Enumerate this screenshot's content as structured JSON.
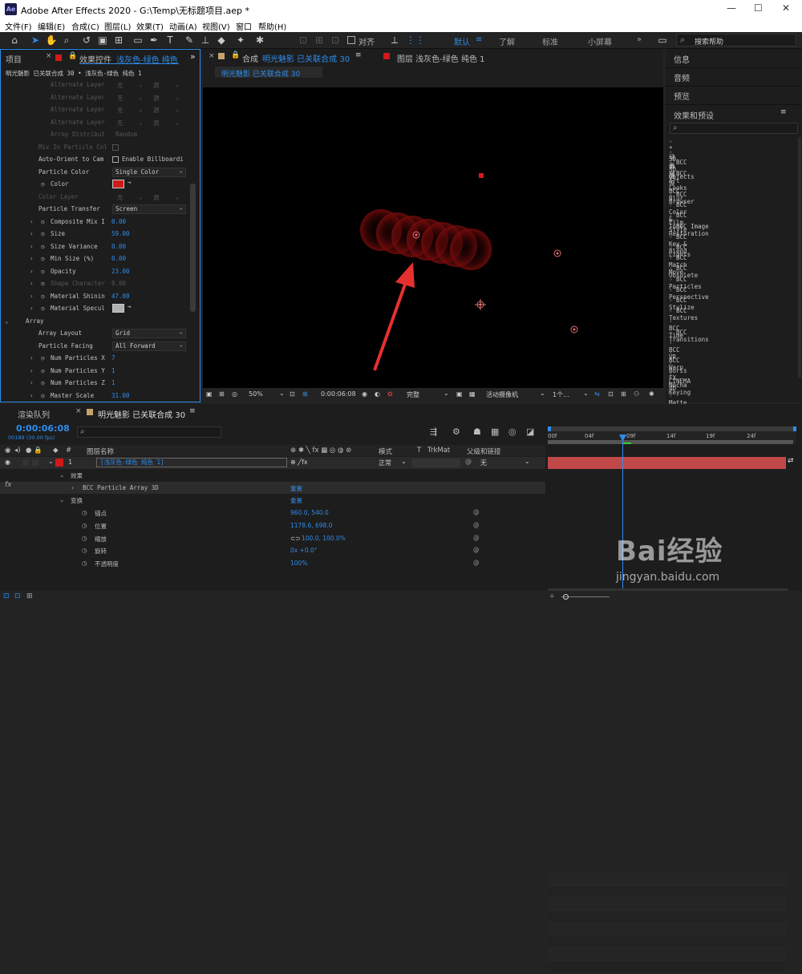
{
  "app": {
    "title": "Adobe After Effects 2020 - G:\\Temp\\无标题项目.aep *",
    "logo": "Ae"
  },
  "menu": [
    "文件(F)",
    "编辑(E)",
    "合成(C)",
    "图层(L)",
    "效果(T)",
    "动画(A)",
    "视图(V)",
    "窗口",
    "帮助(H)"
  ],
  "toolbar": {
    "snap_label": "对齐",
    "workspaces": [
      "默认",
      "了解",
      "标准",
      "小屏幕"
    ],
    "search_placeholder": "搜索帮助"
  },
  "left_panel": {
    "tab_project": "项目",
    "tab_effects_prefix": "效果控件",
    "tab_effects_layer": "浅灰色-绿色 纯色",
    "breadcrumb": "明光魅影 已关联合成 30 • 浅灰色-绿色 纯色 1",
    "rows": [
      {
        "label": "Alternate Layer",
        "value": "无",
        "kind": "dd2",
        "dis": true,
        "indent": 62
      },
      {
        "label": "Alternate Layer",
        "value": "无",
        "kind": "dd2",
        "dis": true,
        "indent": 62
      },
      {
        "label": "Alternate Layer",
        "value": "无",
        "kind": "dd2",
        "dis": true,
        "indent": 62
      },
      {
        "label": "Alternate Layer",
        "value": "无",
        "kind": "dd2",
        "dis": true,
        "indent": 62
      },
      {
        "label": "Array Distribut",
        "value": "Random",
        "kind": "text",
        "dis": true,
        "indent": 62
      },
      {
        "label": "Mix In Particle Col",
        "value": "",
        "kind": "check",
        "dis": true,
        "indent": 47
      },
      {
        "label": "Auto-Orient to Cam",
        "value": "Enable Billboardi",
        "kind": "check",
        "dis": false,
        "indent": 47
      },
      {
        "label": "Particle Color",
        "value": "Single Color",
        "kind": "dd",
        "dis": false,
        "indent": 47
      },
      {
        "label": "Color",
        "value": "",
        "kind": "color",
        "dis": false,
        "indent": 62,
        "sw": true
      },
      {
        "label": "Color Layer",
        "value": "无",
        "kind": "dd2",
        "dis": true,
        "indent": 47
      },
      {
        "label": "Particle Transfer",
        "value": "Screen",
        "kind": "dd",
        "dis": false,
        "indent": 47
      },
      {
        "label": "Composite Mix I",
        "value": "0.00",
        "kind": "num",
        "dis": false,
        "indent": 62,
        "sw": true,
        "tw": true
      },
      {
        "label": "Size",
        "value": "59.00",
        "kind": "num",
        "dis": false,
        "indent": 62,
        "sw": true,
        "tw": true
      },
      {
        "label": "Size Variance",
        "value": "0.00",
        "kind": "num",
        "dis": false,
        "indent": 62,
        "sw": true,
        "tw": true
      },
      {
        "label": "Min Size (%)",
        "value": "0.00",
        "kind": "num",
        "dis": false,
        "indent": 62,
        "sw": true,
        "tw": true
      },
      {
        "label": "Opacity",
        "value": "23.00",
        "kind": "num",
        "dis": false,
        "indent": 62,
        "sw": true,
        "tw": true
      },
      {
        "label": "Shape Character",
        "value": "0.00",
        "kind": "num",
        "dis": true,
        "indent": 62,
        "sw": true,
        "tw": true
      },
      {
        "label": "Material Shinin",
        "value": "47.00",
        "kind": "num",
        "dis": false,
        "indent": 62,
        "sw": true,
        "tw": true
      },
      {
        "label": "Material Specul",
        "value": "",
        "kind": "gray",
        "dis": false,
        "indent": 62,
        "sw": true,
        "tw": true
      },
      {
        "label": "Array",
        "value": "",
        "kind": "group",
        "dis": false,
        "indent": 31,
        "tw": true
      },
      {
        "label": "Array Layout",
        "value": "Grid",
        "kind": "dd",
        "dis": false,
        "indent": 47
      },
      {
        "label": "Particle Facing",
        "value": "All Forward",
        "kind": "dd",
        "dis": false,
        "indent": 47
      },
      {
        "label": "Num Particles X",
        "value": "7",
        "kind": "num",
        "dis": false,
        "indent": 62,
        "sw": true,
        "tw": true
      },
      {
        "label": "Num Particles Y",
        "value": "1",
        "kind": "num",
        "dis": false,
        "indent": 62,
        "sw": true,
        "tw": true
      },
      {
        "label": "Num Particles Z",
        "value": "1",
        "kind": "num",
        "dis": false,
        "indent": 62,
        "sw": true,
        "tw": true
      },
      {
        "label": "Master Scale",
        "value": "31.00",
        "kind": "num",
        "dis": false,
        "indent": 62,
        "sw": true,
        "tw": true
      }
    ]
  },
  "comp_panel": {
    "tab_comp_prefix": "合成",
    "tab_comp_name": "明光魅影 已关联合成 30",
    "tab_layer": "图层 浅灰色-绿色 纯色 1",
    "subtab": "明光魅影 已关联合成 30"
  },
  "viewer_footer": {
    "zoom": "50%",
    "timecode": "0:00:06:08",
    "resolution": "完整",
    "camera": "活动摄像机",
    "views": "1个..."
  },
  "right_panel": {
    "info": "信息",
    "audio": "音频",
    "preview": "预览",
    "effects_title": "效果和预设",
    "items": [
      "* 动画预设",
      "3D 声道",
      "BCC 3D Objects",
      "BCC Art Looks",
      "BCC Blur",
      "BCC Browser",
      "BCC Color & Tone",
      "BCC Film Style",
      "BCC Image Restoration",
      "BCC Key & Blend",
      "BCC Lights",
      "BCC Match Move",
      "BCC Obsolete",
      "BCC Particles",
      "BCC Perspective",
      "BCC Stylize",
      "BCC Textures",
      "BCC Time",
      "BCC Transitions",
      "BCC VR",
      "BCC Warp",
      "Boris FX Mocha",
      "CINEMA 4D",
      "Keying",
      "Matte"
    ]
  },
  "timeline": {
    "tab_render": "渲染队列",
    "tab_comp": "明光魅影 已关联合成 30",
    "timecode": "0:00:06:08",
    "frames": "00188 (30.00 fps)",
    "col_layer": "图层名称",
    "col_mode": "模式",
    "col_trkmat": "TrkMat",
    "col_parent": "父级和链接",
    "layer": {
      "num": "1",
      "name": "[浅灰色-绿色 纯色 1]",
      "mode": "正常",
      "parent": "无"
    },
    "ruler": [
      "00f",
      "04f",
      "09f",
      "14f",
      "19f",
      "24f"
    ],
    "rows": [
      {
        "label": "效果",
        "value": "",
        "indent": 88,
        "tw": true
      },
      {
        "label": "BCC Particle Array 3D",
        "value": "重置",
        "indent": 103,
        "tw": true,
        "fx": true
      },
      {
        "label": "变换",
        "value": "重置",
        "indent": 88,
        "tw": true
      },
      {
        "label": "锚点",
        "value": "960.0, 540.0",
        "indent": 118,
        "sw": true,
        "link": true
      },
      {
        "label": "位置",
        "value": "1178.6, 698.0",
        "indent": 118,
        "sw": true,
        "link": true
      },
      {
        "label": "缩放",
        "value": "100.0, 100.0%",
        "indent": 118,
        "sw": true,
        "link": true,
        "chain": true
      },
      {
        "label": "旋转",
        "value": "0x +0.0°",
        "indent": 118,
        "sw": true,
        "link": true
      },
      {
        "label": "不透明度",
        "value": "100%",
        "indent": 118,
        "sw": true,
        "link": true
      }
    ]
  },
  "watermark": {
    "brand": "Bai经验",
    "url": "jingyan.baidu.com"
  },
  "colors": {
    "accent": "#2d8ceb",
    "layer_red": "#c84444",
    "swatch_red": "#d01a1a"
  }
}
